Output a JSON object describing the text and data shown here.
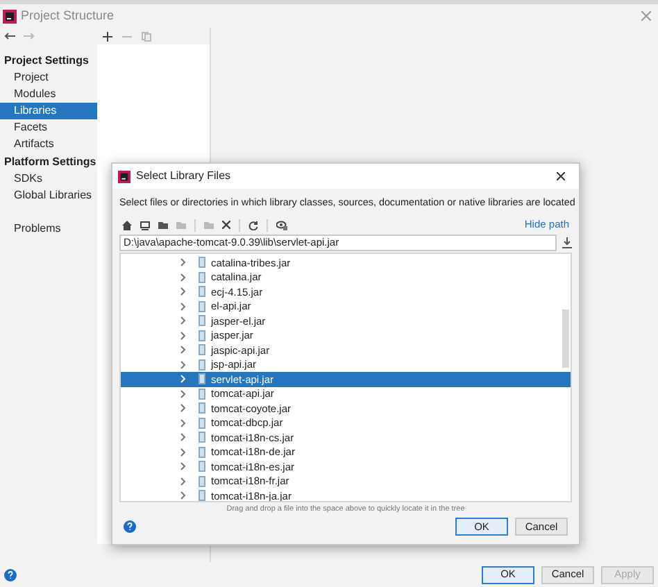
{
  "window": {
    "title": "Project Structure"
  },
  "sidebar": {
    "sections": [
      {
        "heading": "Project Settings",
        "items": [
          {
            "label": "Project",
            "selected": false
          },
          {
            "label": "Modules",
            "selected": false
          },
          {
            "label": "Libraries",
            "selected": true
          },
          {
            "label": "Facets",
            "selected": false
          },
          {
            "label": "Artifacts",
            "selected": false
          }
        ]
      },
      {
        "heading": "Platform Settings",
        "items": [
          {
            "label": "SDKs",
            "selected": false
          },
          {
            "label": "Global Libraries",
            "selected": false
          }
        ]
      }
    ],
    "extra_items": [
      {
        "label": "Problems",
        "selected": false
      }
    ]
  },
  "dialog": {
    "title": "Select Library Files",
    "description": "Select files or directories in which library classes, sources, documentation or native libraries are located",
    "hide_path": "Hide path",
    "path": "D:\\java\\apache-tomcat-9.0.39\\lib\\servlet-api.jar",
    "files": [
      {
        "name": "catalina-tribes.jar",
        "selected": false
      },
      {
        "name": "catalina.jar",
        "selected": false
      },
      {
        "name": "ecj-4.15.jar",
        "selected": false
      },
      {
        "name": "el-api.jar",
        "selected": false
      },
      {
        "name": "jasper-el.jar",
        "selected": false
      },
      {
        "name": "jasper.jar",
        "selected": false
      },
      {
        "name": "jaspic-api.jar",
        "selected": false
      },
      {
        "name": "jsp-api.jar",
        "selected": false
      },
      {
        "name": "servlet-api.jar",
        "selected": true
      },
      {
        "name": "tomcat-api.jar",
        "selected": false
      },
      {
        "name": "tomcat-coyote.jar",
        "selected": false
      },
      {
        "name": "tomcat-dbcp.jar",
        "selected": false
      },
      {
        "name": "tomcat-i18n-cs.jar",
        "selected": false
      },
      {
        "name": "tomcat-i18n-de.jar",
        "selected": false
      },
      {
        "name": "tomcat-i18n-es.jar",
        "selected": false
      },
      {
        "name": "tomcat-i18n-fr.jar",
        "selected": false
      },
      {
        "name": "tomcat-i18n-ja.jar",
        "selected": false
      }
    ],
    "hint": "Drag and drop a file into the space above to quickly locate it in the tree",
    "buttons": [
      {
        "label": "OK",
        "default": true
      },
      {
        "label": "Cancel",
        "default": false
      }
    ]
  },
  "buttons": [
    {
      "label": "OK",
      "default": true,
      "disabled": false
    },
    {
      "label": "Cancel",
      "default": false,
      "disabled": false
    },
    {
      "label": "Apply",
      "default": false,
      "disabled": true
    }
  ]
}
